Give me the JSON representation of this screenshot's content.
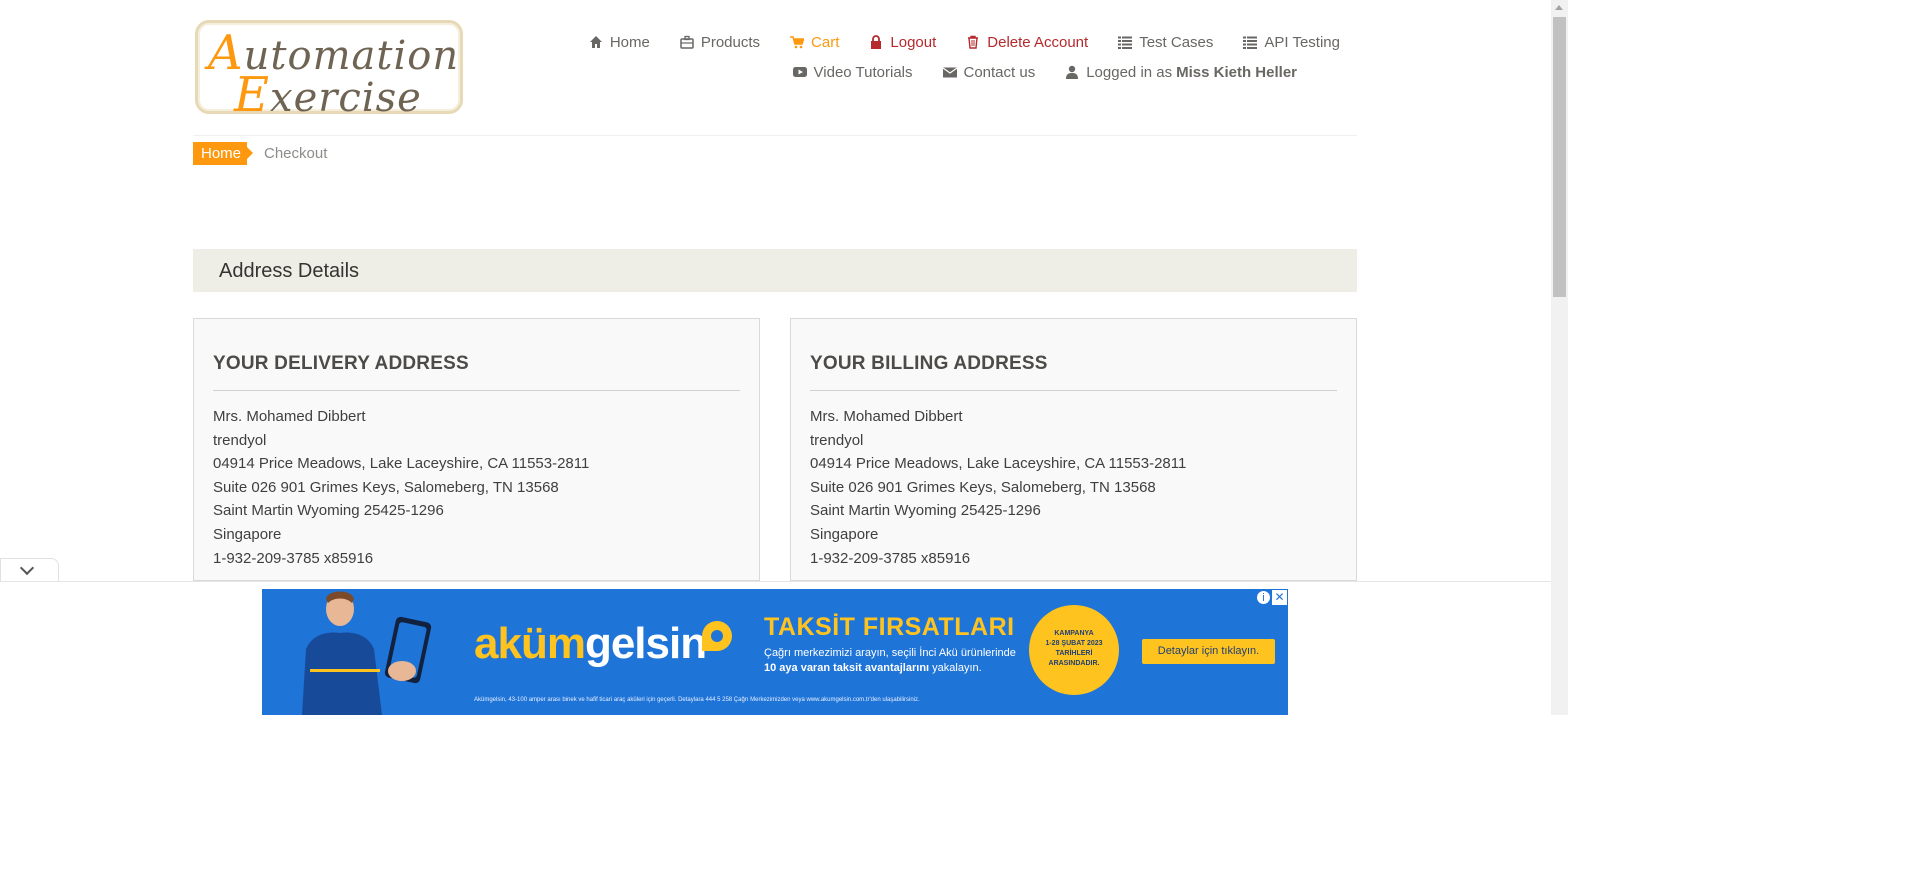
{
  "header": {
    "logo": {
      "line1_cap": "A",
      "line1_rest": "utomation",
      "line2_cap": "E",
      "line2_rest": "xercise"
    },
    "nav": [
      {
        "label": "Home",
        "icon": "home-icon"
      },
      {
        "label": "Products",
        "icon": "products-icon"
      },
      {
        "label": "Cart",
        "icon": "cart-icon"
      },
      {
        "label": "Logout",
        "icon": "lock-icon"
      },
      {
        "label": "Delete Account",
        "icon": "trash-icon"
      },
      {
        "label": "Test Cases",
        "icon": "list-icon"
      },
      {
        "label": "API Testing",
        "icon": "list-icon"
      },
      {
        "label": "Video Tutorials",
        "icon": "youtube-icon"
      },
      {
        "label": "Contact us",
        "icon": "envelope-icon"
      }
    ],
    "logged_in_prefix": "Logged in as",
    "logged_in_user": "Miss Kieth Heller",
    "colors": {
      "accent": "#fe980f",
      "danger": "#b6292d",
      "text": "#696763"
    }
  },
  "breadcrumb": {
    "home": "Home",
    "active": "Checkout"
  },
  "address_section": {
    "title": "Address Details"
  },
  "delivery": {
    "title": "YOUR DELIVERY ADDRESS",
    "lines": [
      "Mrs. Mohamed Dibbert",
      "trendyol",
      "04914 Price Meadows, Lake Laceyshire, CA 11553-2811",
      "Suite 026 901 Grimes Keys, Salomeberg, TN 13568",
      "Saint Martin Wyoming 25425-1296",
      "Singapore",
      "1-932-209-3785 x85916"
    ]
  },
  "billing": {
    "title": "YOUR BILLING ADDRESS",
    "lines": [
      "Mrs. Mohamed Dibbert",
      "trendyol",
      "04914 Price Meadows, Lake Laceyshire, CA 11553-2811",
      "Suite 026 901 Grimes Keys, Salomeberg, TN 13568",
      "Saint Martin Wyoming 25425-1296",
      "Singapore",
      "1-932-209-3785 x85916"
    ]
  },
  "ad": {
    "brand_part1": "aküm",
    "brand_part2": "gelsin",
    "headline": "TAKSİT FIRSATLARI",
    "line1": "Çağrı merkezimizi arayın, seçili İnci Akü ürünlerinde",
    "line2_bold": "10 aya varan taksit avantajlarını",
    "line2_rest": "yakalayın.",
    "badge_l1": "KAMPANYA",
    "badge_l2": "1-28 ŞUBAT 2023",
    "badge_l3": "TARİHLERİ",
    "badge_l4": "ARASINDADIR.",
    "cta": "Detaylar için tıklayın.",
    "fine_print": "Akümgelsin, 43-100 amper arası binek ve hafif ticari araç aküleri için geçerli. Detaylara 444 5 258 Çağrı Merkezimizden veya www.akumgelsin.com.tr'den ulaşabilirsiniz.",
    "info_glyph": "i",
    "close_glyph": "✕"
  }
}
